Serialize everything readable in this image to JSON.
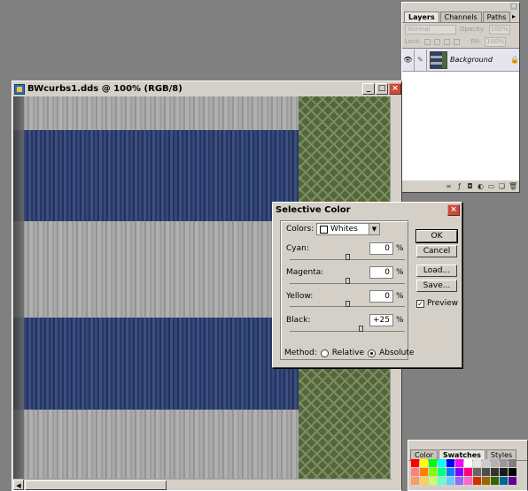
{
  "layers_palette": {
    "tabs": [
      "Layers",
      "Channels",
      "Paths"
    ],
    "blend_mode": "Normal",
    "opacity_label": "Opacity:",
    "opacity_value": "100%",
    "lock_label": "Lock:",
    "fill_label": "Fill:",
    "fill_value": "100%",
    "layer_name": "Background"
  },
  "document": {
    "title": "BWcurbs1.dds @ 100% (RGB/8)"
  },
  "dialog": {
    "title": "Selective Color",
    "colors_label": "Colors:",
    "colors_value": "Whites",
    "cyan_label": "Cyan:",
    "cyan_value": "0",
    "magenta_label": "Magenta:",
    "magenta_value": "0",
    "yellow_label": "Yellow:",
    "yellow_value": "0",
    "black_label": "Black:",
    "black_value": "+25",
    "percent": "%",
    "ok_label": "OK",
    "cancel_label": "Cancel",
    "load_label": "Load...",
    "save_label": "Save...",
    "preview_label": "Preview",
    "preview_checked": true,
    "method_label": "Method:",
    "relative_label": "Relative",
    "absolute_label": "Absolute",
    "method_selected": "Absolute"
  },
  "swatches_palette": {
    "tabs": [
      "Color",
      "Swatches",
      "Styles"
    ],
    "colors": [
      "#ff0000",
      "#ffff00",
      "#00ff00",
      "#00ffff",
      "#0000ff",
      "#ff00ff",
      "#ffffff",
      "#e6e6e6",
      "#cccccc",
      "#b3b3b3",
      "#999999",
      "#808080",
      "#ff8080",
      "#ff8000",
      "#80ff00",
      "#00ff80",
      "#0080ff",
      "#8000ff",
      "#ff0080",
      "#666666",
      "#4d4d4d",
      "#333333",
      "#1a1a1a",
      "#000000",
      "#ff9966",
      "#ffcc66",
      "#ccff66",
      "#66ffcc",
      "#66ccff",
      "#9966ff",
      "#ff66cc",
      "#cc3300",
      "#996600",
      "#336600",
      "#006699",
      "#660099"
    ]
  }
}
